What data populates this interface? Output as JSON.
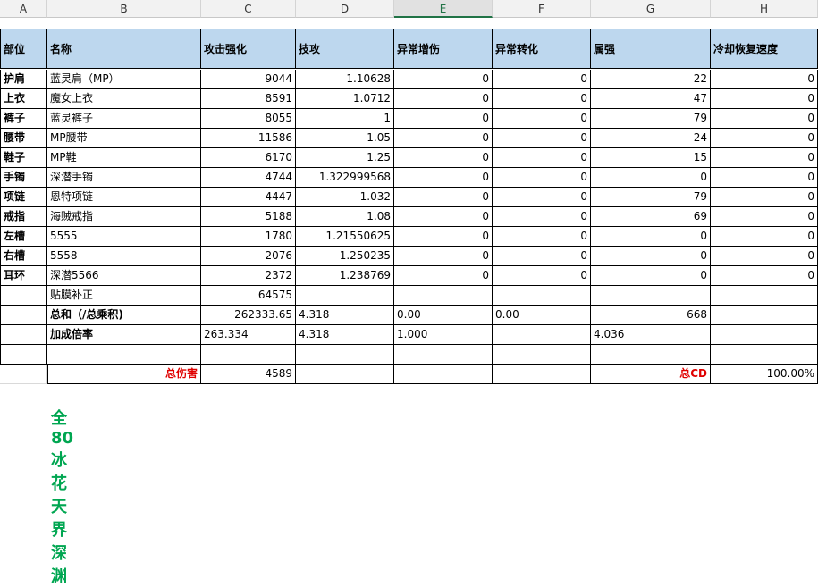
{
  "columns": [
    "A",
    "B",
    "C",
    "D",
    "E",
    "F",
    "G",
    "H"
  ],
  "headers": [
    "部位",
    "名称",
    "攻击强化",
    "技攻",
    "异常增伤",
    "异常转化",
    "属强",
    "冷却恢复速度"
  ],
  "rows": [
    [
      "护肩",
      "蓝灵肩（MP）",
      "9044",
      "1.10628",
      "0",
      "0",
      "22",
      "0"
    ],
    [
      "上衣",
      "魔女上衣",
      "8591",
      "1.0712",
      "0",
      "0",
      "47",
      "0"
    ],
    [
      "裤子",
      "蓝灵裤子",
      "8055",
      "1",
      "0",
      "0",
      "79",
      "0"
    ],
    [
      "腰带",
      "MP腰带",
      "11586",
      "1.05",
      "0",
      "0",
      "24",
      "0"
    ],
    [
      "鞋子",
      "MP鞋",
      "6170",
      "1.25",
      "0",
      "0",
      "15",
      "0"
    ],
    [
      "手镯",
      "深潜手镯",
      "4744",
      "1.322999568",
      "0",
      "0",
      "0",
      "0"
    ],
    [
      "项链",
      "恩特项链",
      "4447",
      "1.032",
      "0",
      "0",
      "79",
      "0"
    ],
    [
      "戒指",
      "海贼戒指",
      "5188",
      "1.08",
      "0",
      "0",
      "69",
      "0"
    ],
    [
      "左槽",
      "5555",
      "1780",
      "1.21550625",
      "0",
      "0",
      "0",
      "0"
    ],
    [
      "右槽",
      "5558",
      "2076",
      "1.250235",
      "0",
      "0",
      "0",
      "0"
    ],
    [
      "耳环",
      "深潜5566",
      "2372",
      "1.238769",
      "0",
      "0",
      "0",
      "0"
    ]
  ],
  "correction": {
    "label": "贴膜补正",
    "value": "64575"
  },
  "sum": {
    "label": "总和（/总乘积)",
    "c": "262333.65",
    "d": "4.318",
    "e": "0.00",
    "f": "0.00",
    "g": "668"
  },
  "rate": {
    "label": "加成倍率",
    "c": "263.334",
    "d": "4.318",
    "e": "1.000",
    "g": "4.036"
  },
  "total": {
    "damage_label": "总伤害",
    "damage": "4589",
    "cd_label": "总CD",
    "cd": "100.00%"
  },
  "sheet_title": "全80冰花天界深渊"
}
